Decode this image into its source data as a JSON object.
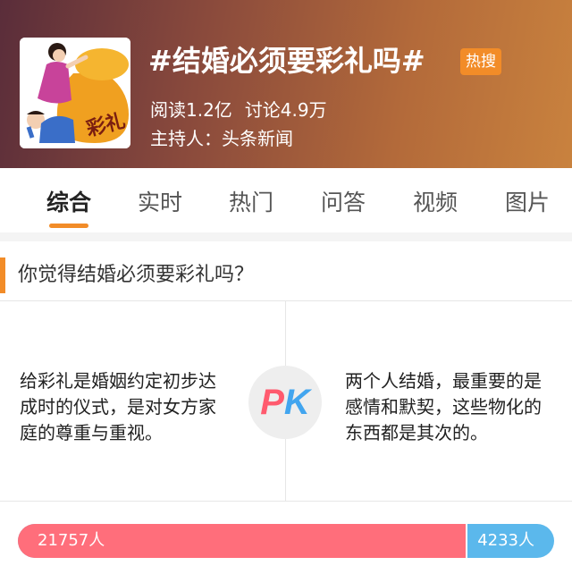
{
  "header": {
    "cover_caption": "彩礼",
    "title": "#结婚必须要彩礼吗#",
    "badge": "热搜",
    "reads": "阅读1.2亿",
    "discussions": "讨论4.9万",
    "host": "主持人：头条新闻"
  },
  "tabs": [
    {
      "label": "综合",
      "active": true
    },
    {
      "label": "实时",
      "active": false
    },
    {
      "label": "热门",
      "active": false
    },
    {
      "label": "问答",
      "active": false
    },
    {
      "label": "视频",
      "active": false
    },
    {
      "label": "图片",
      "active": false
    }
  ],
  "pk": {
    "question": "你觉得结婚必须要彩礼吗？",
    "left_opinion": "给彩礼是婚姻约定初步达成时的仪式，是对女方家庭的尊重与重视。",
    "right_opinion": "两个人结婚，最重要的是感情和默契，这些物化的东西都是其次的。",
    "badge_p": "P",
    "badge_k": "K",
    "left_votes": 21757,
    "right_votes": 4233,
    "left_votes_label": "21757人",
    "right_votes_label": "4233人"
  },
  "colors": {
    "accent": "#f28c28",
    "pro": "#ff6e7b",
    "con": "#5bb8ec"
  }
}
